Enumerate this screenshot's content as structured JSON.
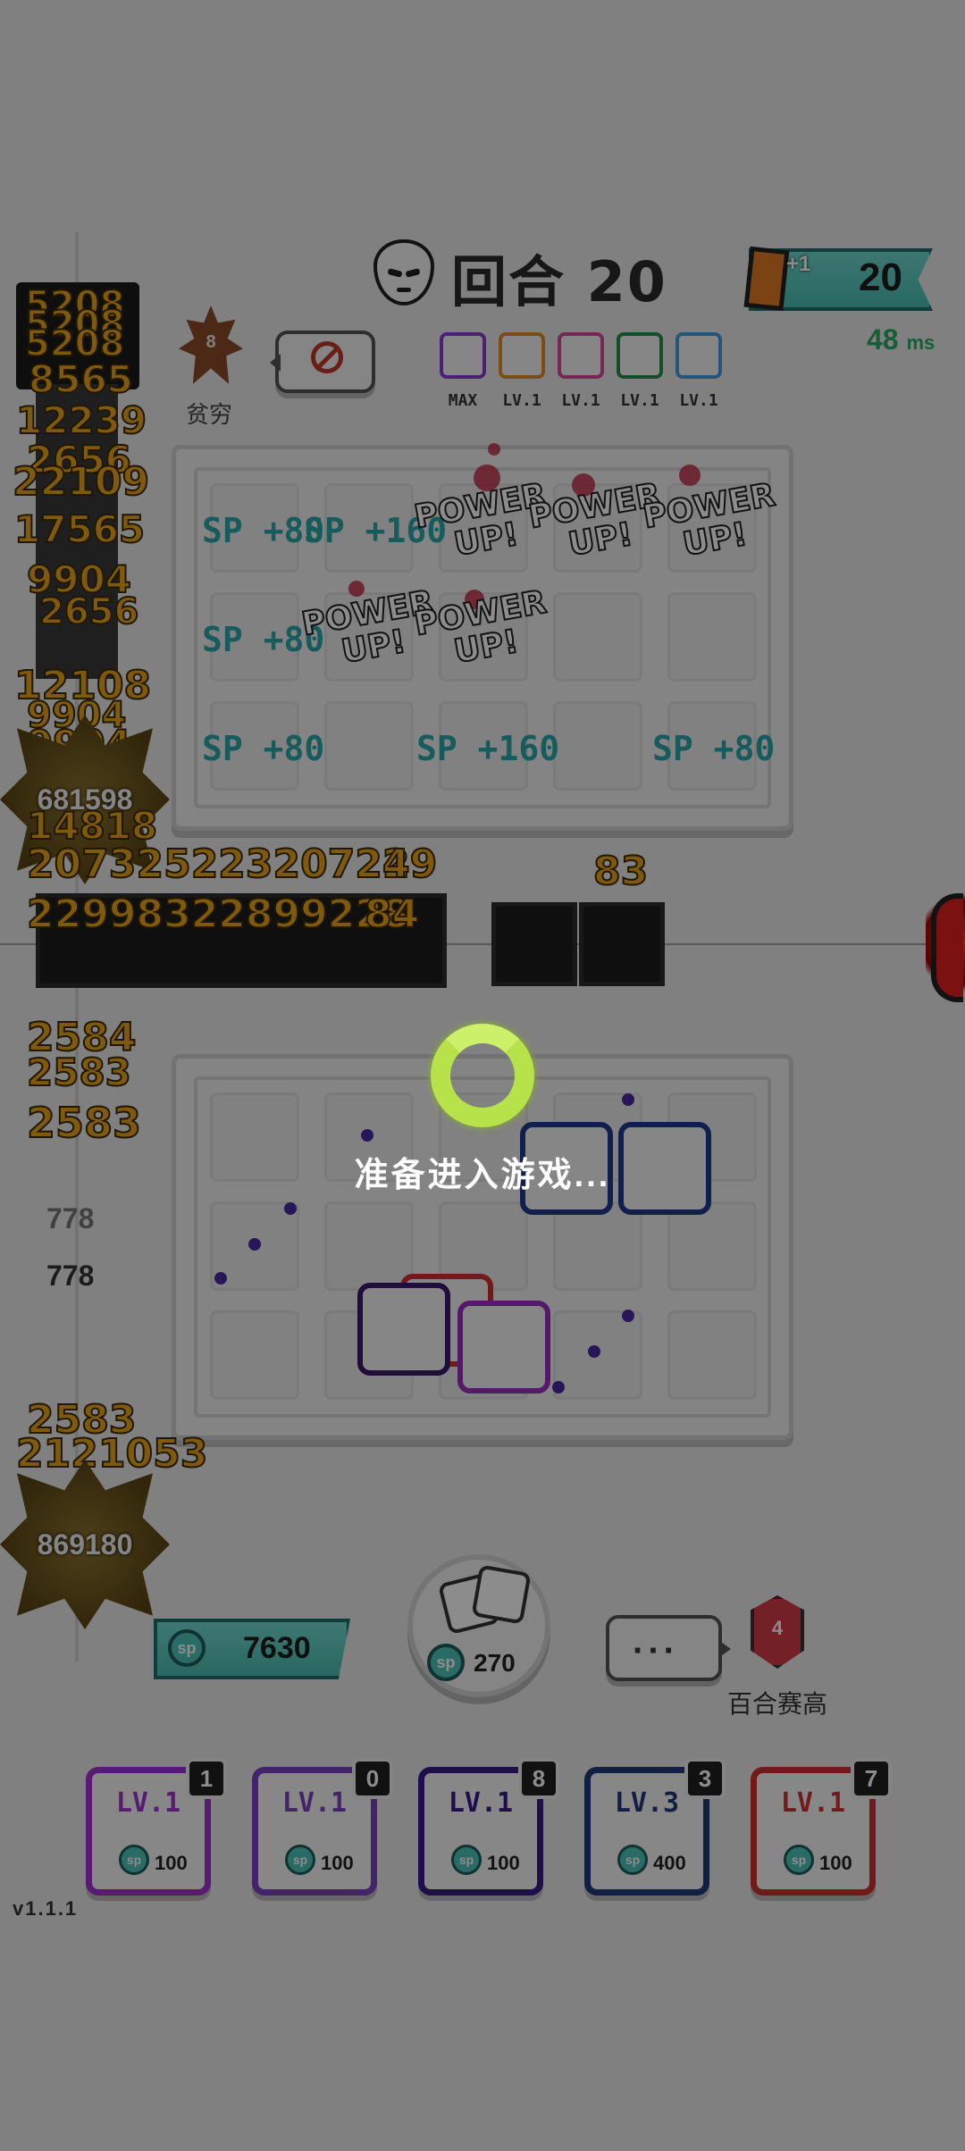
{
  "hud": {
    "round_label": "回合 20",
    "card_bonus": "+1",
    "card_count": "20",
    "ping_value": "48",
    "ping_unit": "ms"
  },
  "opponent": {
    "rank_badge": "8",
    "rank_name": "贫穷",
    "deck_levels": [
      "MAX",
      "LV.1",
      "LV.1",
      "LV.1",
      "LV.1"
    ],
    "deck_colors": [
      "#8b3bd6",
      "#e08a2a",
      "#d64a9c",
      "#2a8a4a",
      "#4a9ad6"
    ]
  },
  "top_board": {
    "sp_popups": [
      "SP +80",
      "SP +160",
      "SP +80",
      "SP +80",
      "SP +160",
      "SP +80"
    ],
    "powerups": [
      "POWER UP!",
      "POWER UP!",
      "POWER UP!",
      "POWER UP!",
      "POWER UP!"
    ]
  },
  "damage_log": {
    "stack_top": [
      "5208",
      "5208",
      "5208",
      "8565",
      "12239",
      "2656",
      "22109",
      "17565",
      "9904",
      "2656",
      "12108",
      "9904",
      "9904"
    ],
    "opponent_hp": "681598",
    "mid_numbers": [
      "14818",
      "20732522320722",
      "49",
      "83"
    ],
    "mid_row2": "22998322899228",
    "mid_row2_tail": "84",
    "left_mid": [
      "2584",
      "2583",
      "2583"
    ],
    "small_hp": [
      "778",
      "778"
    ],
    "bottom": [
      "2583",
      "2121053"
    ],
    "player_hp": "869180"
  },
  "loading": {
    "text": "准备进入游戏..."
  },
  "player": {
    "sp_total": "7630",
    "roll_cost": "270",
    "chat": "···",
    "rank_badge": "4",
    "rank_name": "百合赛高",
    "sp_icon": "sp"
  },
  "deck": [
    {
      "lv": "LV.1",
      "cost": "100",
      "count": "1",
      "color": "#a030d0"
    },
    {
      "lv": "LV.1",
      "cost": "100",
      "count": "0",
      "color": "#7a40c0"
    },
    {
      "lv": "LV.1",
      "cost": "100",
      "count": "8",
      "color": "#3a1a8a"
    },
    {
      "lv": "LV.3",
      "cost": "400",
      "count": "3",
      "color": "#1f3a7a"
    },
    {
      "lv": "LV.1",
      "cost": "100",
      "count": "7",
      "color": "#d03030"
    }
  ],
  "version": "v1.1.1"
}
